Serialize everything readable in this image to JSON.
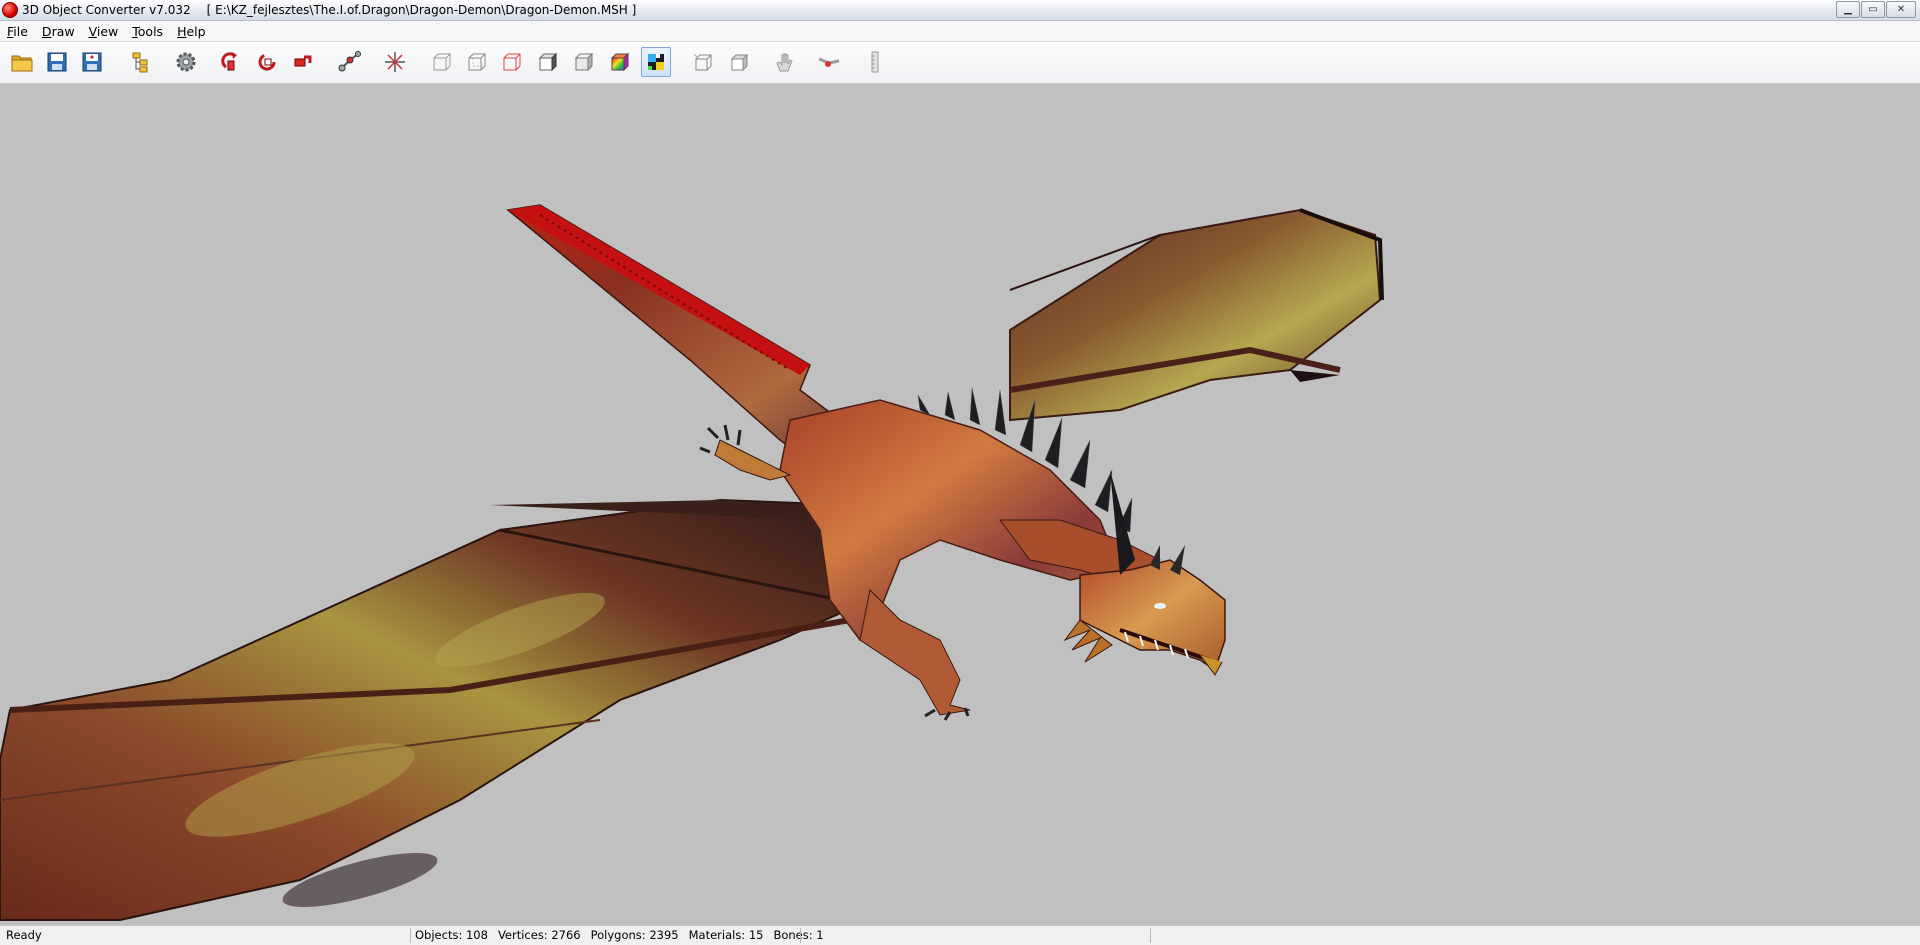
{
  "window": {
    "app_title": "3D Object Converter v7.032",
    "file_path": "[ E:\\KZ_fejlesztes\\The.I.of.Dragon\\Dragon-Demon\\Dragon-Demon.MSH ]",
    "controls": [
      "minimize",
      "maximize",
      "close"
    ]
  },
  "menu": {
    "items": [
      {
        "accel": "F",
        "rest": "ile"
      },
      {
        "accel": "D",
        "rest": "raw"
      },
      {
        "accel": "V",
        "rest": "iew"
      },
      {
        "accel": "T",
        "rest": "ools"
      },
      {
        "accel": "H",
        "rest": "elp"
      }
    ]
  },
  "toolbar": {
    "buttons": [
      "open-folder-icon",
      "save-disk-icon",
      "save-as-disk-icon",
      "objects-tree-icon",
      "settings-gear-icon",
      "rotate-x-icon",
      "rotate-y-icon",
      "rotate-z-icon",
      "bones-icon",
      "axis-center-icon",
      "wireframe-cube-icon",
      "wireframe-cube-2-icon",
      "red-wireframe-cube-icon",
      "flat-cube-icon",
      "smooth-cube-icon",
      "color-cube-icon",
      "texture-checker-icon",
      "normals-cube-icon",
      "backface-cube-icon",
      "hand-pan-icon",
      "zoom-tool-icon",
      "measure-tool-icon"
    ],
    "active_button": "texture-checker-icon"
  },
  "status": {
    "state": "Ready",
    "objects_label": "Objects: 108",
    "vertices_label": "Vertices: 2766",
    "polygons_label": "Polygons: 2395",
    "materials_label": "Materials: 15",
    "bones_label": "Bones: 1"
  },
  "viewport": {
    "background": "#c0c0c0",
    "model": "dragon"
  }
}
